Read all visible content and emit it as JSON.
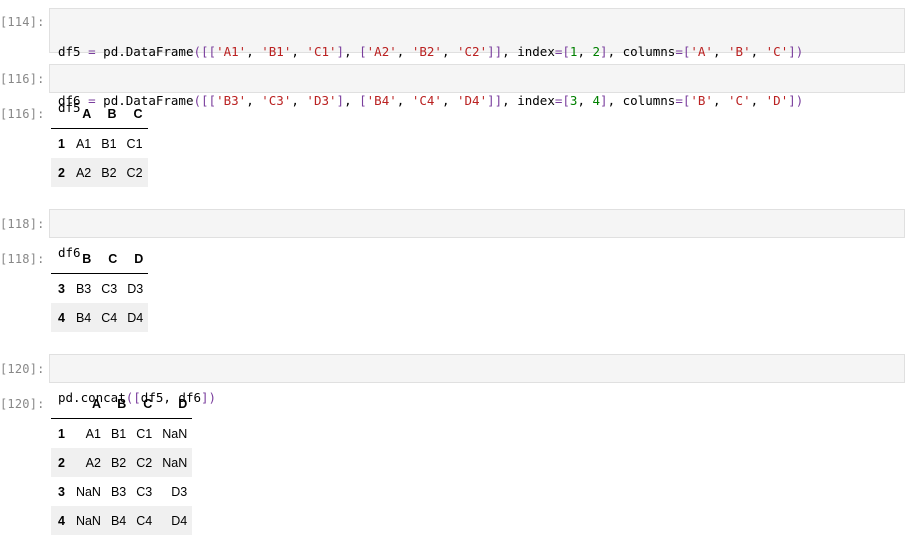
{
  "cells": [
    {
      "prompt": "[114]:",
      "code_lines": [
        "df5 = pd.DataFrame([['A1', 'B1', 'C1'], ['A2', 'B2', 'C2']], index=[1, 2], columns=['A', 'B', 'C'])",
        "df6 = pd.DataFrame([['B3', 'C3', 'D3'], ['B4', 'C4', 'D4']], index=[3, 4], columns=['B', 'C', 'D'])"
      ]
    },
    {
      "prompt": "[116]:",
      "code_lines": [
        "df5"
      ],
      "output_prompt": "[116]:",
      "table": {
        "columns": [
          "",
          "A",
          "B",
          "C"
        ],
        "rows": [
          {
            "index": "1",
            "values": [
              "A1",
              "B1",
              "C1"
            ]
          },
          {
            "index": "2",
            "values": [
              "A2",
              "B2",
              "C2"
            ]
          }
        ]
      }
    },
    {
      "prompt": "[118]:",
      "code_lines": [
        "df6"
      ],
      "output_prompt": "[118]:",
      "table": {
        "columns": [
          "",
          "B",
          "C",
          "D"
        ],
        "rows": [
          {
            "index": "3",
            "values": [
              "B3",
              "C3",
              "D3"
            ]
          },
          {
            "index": "4",
            "values": [
              "B4",
              "C4",
              "D4"
            ]
          }
        ]
      }
    },
    {
      "prompt": "[120]:",
      "code_lines": [
        "pd.concat([df5, df6])"
      ],
      "output_prompt": "[120]:",
      "table": {
        "columns": [
          "",
          "A",
          "B",
          "C",
          "D"
        ],
        "rows": [
          {
            "index": "1",
            "values": [
              "A1",
              "B1",
              "C1",
              "NaN"
            ]
          },
          {
            "index": "2",
            "values": [
              "A2",
              "B2",
              "C2",
              "NaN"
            ]
          },
          {
            "index": "3",
            "values": [
              "NaN",
              "B3",
              "C3",
              "D3"
            ]
          },
          {
            "index": "4",
            "values": [
              "NaN",
              "B4",
              "C4",
              "D4"
            ]
          }
        ]
      }
    }
  ],
  "colors": {
    "function": "#2b5fa8",
    "operator": "#7a3e9d",
    "string": "#ba2121",
    "number": "#008000",
    "prompt": "#888888",
    "cell_bg": "#f5f5f5",
    "row_stripe": "#f0f0f0"
  }
}
